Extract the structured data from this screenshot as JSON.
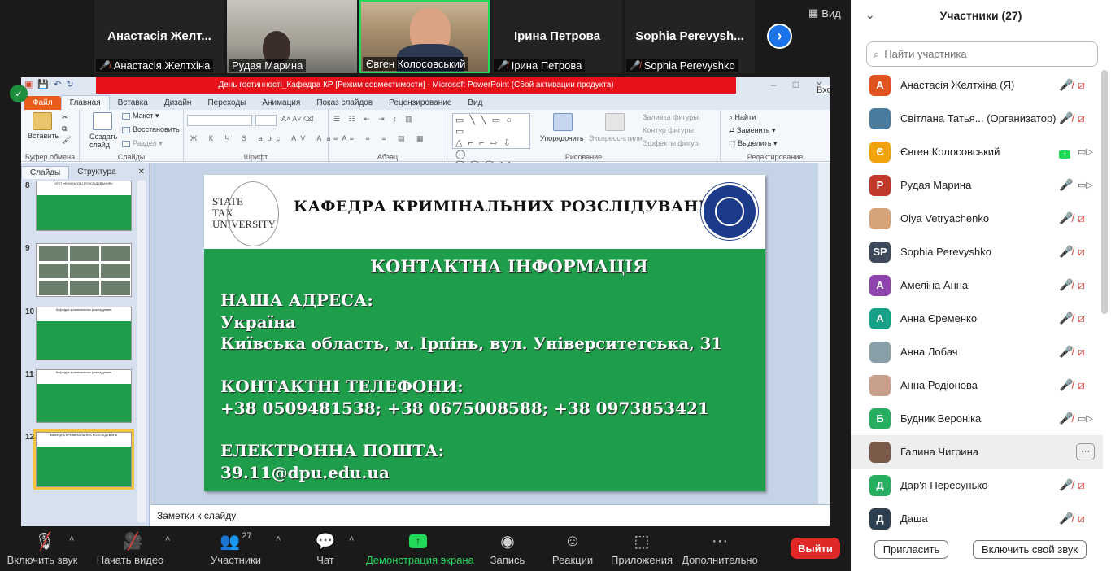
{
  "gallery": {
    "tiles": [
      {
        "big_name": "Анастасія Желт...",
        "tag": "Анастасія Желтхіна",
        "muted": true
      },
      {
        "tag": "Рудая Марина",
        "muted": false
      },
      {
        "tag": "Євген Колосовський",
        "muted": false
      },
      {
        "big_name": "Ірина Петрова",
        "tag": "Ірина Петрова",
        "muted": true
      },
      {
        "big_name": "Sophia  Perevysh...",
        "tag": "Sophia Perevyshko",
        "muted": true
      }
    ],
    "next_glyph": "›",
    "view_label": "Вид",
    "speaker_border_color": "#23d959"
  },
  "ppt": {
    "window_title": "День гостинності_Кафедра КР [Режим совместимости]  -  Microsoft PowerPoint (Сбой активации продукта)",
    "login_label": "Вход",
    "tabs": [
      "Файл",
      "Главная",
      "Вставка",
      "Дизайн",
      "Переходы",
      "Анимация",
      "Показ слайдов",
      "Рецензирование",
      "Вид"
    ],
    "active_tab": "Главная",
    "ribbon": {
      "clipboard": {
        "label": "Буфер обмена",
        "paste": "Вставить"
      },
      "slides": {
        "label": "Слайды",
        "create": "Создать слайд",
        "layout": "Макет",
        "reset": "Восстановить",
        "section": "Раздел"
      },
      "font": {
        "label": "Шрифт"
      },
      "paragraph": {
        "label": "Абзац"
      },
      "drawing": {
        "label": "Рисование",
        "arrange": "Упорядочить",
        "styles": "Экспресс-стили",
        "fill": "Заливка фигуры",
        "outline": "Контур фигуры",
        "effects": "Эффекты фигур"
      },
      "editing": {
        "label": "Редактирование",
        "find": "Найти",
        "replace": "Заменить",
        "select": "Выделить"
      }
    },
    "pane_tabs": [
      "Слайды",
      "Структура"
    ],
    "thumb_numbers": [
      "8",
      "9",
      "10",
      "11",
      "12"
    ],
    "thumb_heads": [
      "ОПП «ФІНАНСОВІ РОЗСЛІДУВАННЯ»",
      "",
      "Кафедра кримінальних розслідувань",
      "Кафедра кримінальних розслідувань",
      "КАФЕДРА КРИМІНАЛЬНИХ РОЗСЛІДУВАНЬ"
    ],
    "notes_placeholder": "Заметки к слайду",
    "accent_green": "#1e9d4b"
  },
  "slide": {
    "logo_text": [
      "STATE",
      "TAX",
      "UNIVERSITY"
    ],
    "department": "КАФЕДРА КРИМІНАЛЬНИХ  РОЗСЛІДУВАНЬ",
    "heading": "КОНТАКТНА ІНФОРМАЦІЯ",
    "address_title": "НАША АДРЕСА:",
    "address_line1": "Україна",
    "address_line2": "Київська область, м. Ірпінь, вул. Університетська, 31",
    "phones_title": "КОНТАКТНІ ТЕЛЕФОНИ:",
    "phones": "+38 0509481538; +38 0675008588; +38 0973853421",
    "email_title": "ЕЛЕКТРОННА ПОШТА:",
    "email": "39.11@dpu.edu.ua"
  },
  "toolbar": {
    "mute": "Включить звук",
    "video": "Начать видео",
    "participants": "Участники",
    "participants_count": "27",
    "chat": "Чат",
    "share": "Демонстрация экрана",
    "record": "Запись",
    "reactions": "Реакции",
    "apps": "Приложения",
    "more": "Дополнительно",
    "leave": "Выйти",
    "share_color": "#23d959",
    "leave_color": "#e02828"
  },
  "panel": {
    "title": "Участники (27)",
    "search_placeholder": "Найти участника",
    "participants": [
      {
        "initial": "А",
        "name": "Анастасія Желтхіна (Я)",
        "color": "#e0531f",
        "mic": "muted",
        "video": "off"
      },
      {
        "initial": "",
        "name": "Світлана Татья...  (Организатор)",
        "color": "#4a7a9c",
        "mic": "muted",
        "video": "off"
      },
      {
        "initial": "Є",
        "name": "Євген Колосовський",
        "color": "#f0a30a",
        "mic": "sharing",
        "video": "on"
      },
      {
        "initial": "Р",
        "name": "Рудая Марина",
        "color": "#c0392b",
        "mic": "on",
        "video": "on"
      },
      {
        "initial": "",
        "name": "Olya Vetryachenko",
        "color": "#d4a37a",
        "mic": "muted",
        "video": "off"
      },
      {
        "initial": "SP",
        "name": "Sophia Perevyshko",
        "color": "#3d4a5c",
        "mic": "muted",
        "video": "off"
      },
      {
        "initial": "А",
        "name": "Амеліна Анна",
        "color": "#8e44ad",
        "mic": "muted",
        "video": "off"
      },
      {
        "initial": "А",
        "name": "Анна Єременко",
        "color": "#16a085",
        "mic": "muted",
        "video": "off"
      },
      {
        "initial": "",
        "name": "Анна Лобач",
        "color": "#8aa0a8",
        "mic": "muted",
        "video": "off"
      },
      {
        "initial": "",
        "name": "Анна Родіонова",
        "color": "#c9a08a",
        "mic": "muted",
        "video": "off"
      },
      {
        "initial": "Б",
        "name": "Будник Вероніка",
        "color": "#27ae60",
        "mic": "muted",
        "video": "on"
      },
      {
        "initial": "",
        "name": "Галина Чигрина",
        "color": "#7a5a48",
        "mic": "",
        "video": "",
        "more": "···"
      },
      {
        "initial": "Д",
        "name": "Дар'я Пересунько",
        "color": "#27ae60",
        "mic": "muted",
        "video": "off"
      },
      {
        "initial": "Д",
        "name": "Даша",
        "color": "#2c3e50",
        "mic": "muted",
        "video": "off"
      }
    ],
    "invite": "Пригласить",
    "unmute_me": "Включить свой звук"
  }
}
